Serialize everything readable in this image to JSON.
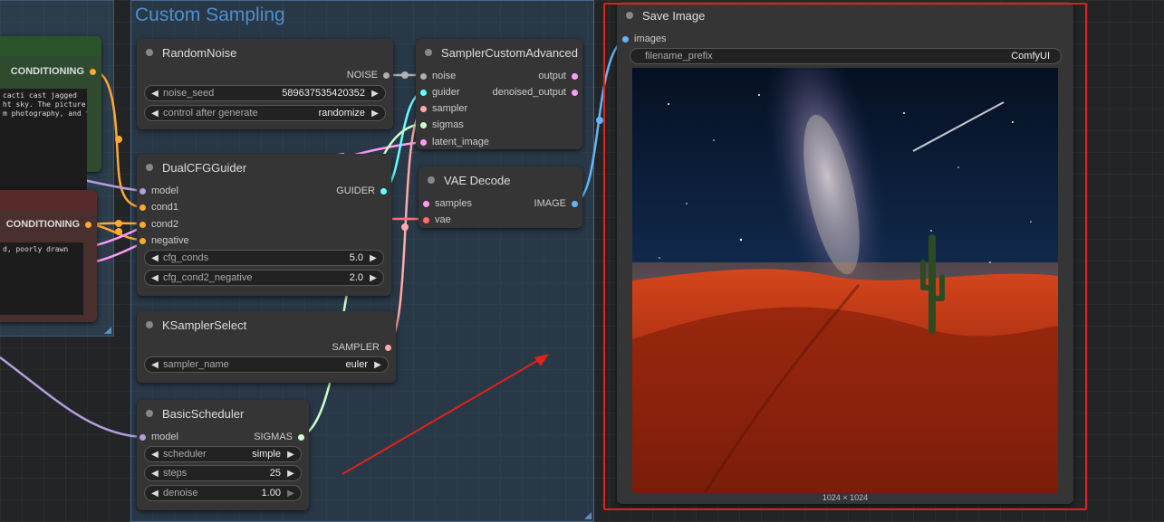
{
  "colors": {
    "conditioning": "#ffa931",
    "noise": "#b0b0b0",
    "guider": "#66ffff",
    "sampler": "#ffaaaa",
    "sigmas": "#cdffcd",
    "latent": "#ff9cf9",
    "image": "#64b5f6",
    "model": "#b39ddb",
    "vae": "#ff6e6e",
    "highlight": "#e0221a"
  },
  "group": {
    "title": "Custom Sampling"
  },
  "left_nodes": {
    "positive": {
      "output_label": "CONDITIONING",
      "text_lines": [
        "cacti cast jagged",
        "ht sky. The picture",
        "m photography, and the"
      ]
    },
    "negative": {
      "output_label": "CONDITIONING",
      "text_lines": [
        "d, poorly drawn"
      ]
    }
  },
  "random_noise": {
    "title": "RandomNoise",
    "output": "NOISE",
    "widgets": [
      {
        "name": "noise_seed",
        "value": "589637535420352"
      },
      {
        "name": "control after generate",
        "value": "randomize"
      }
    ]
  },
  "sampler_custom": {
    "title": "SamplerCustomAdvanced",
    "inputs": [
      "noise",
      "guider",
      "sampler",
      "sigmas",
      "latent_image"
    ],
    "outputs": [
      "output",
      "denoised_output"
    ]
  },
  "dual_cfg": {
    "title": "DualCFGGuider",
    "inputs": [
      "model",
      "cond1",
      "cond2",
      "negative"
    ],
    "output": "GUIDER",
    "widgets": [
      {
        "name": "cfg_conds",
        "value": "5.0"
      },
      {
        "name": "cfg_cond2_negative",
        "value": "2.0"
      }
    ]
  },
  "vae_decode": {
    "title": "VAE Decode",
    "inputs": [
      "samples",
      "vae"
    ],
    "output": "IMAGE"
  },
  "ksampler_select": {
    "title": "KSamplerSelect",
    "output": "SAMPLER",
    "widgets": [
      {
        "name": "sampler_name",
        "value": "euler"
      }
    ]
  },
  "basic_scheduler": {
    "title": "BasicScheduler",
    "input": "model",
    "output": "SIGMAS",
    "widgets": [
      {
        "name": "scheduler",
        "value": "simple"
      },
      {
        "name": "steps",
        "value": "25"
      },
      {
        "name": "denoise",
        "value": "1.00"
      }
    ]
  },
  "save_image": {
    "title": "Save Image",
    "input": "images",
    "widget": {
      "name": "filename_prefix",
      "value": "ComfyUI"
    },
    "image_size": "1024 × 1024"
  }
}
